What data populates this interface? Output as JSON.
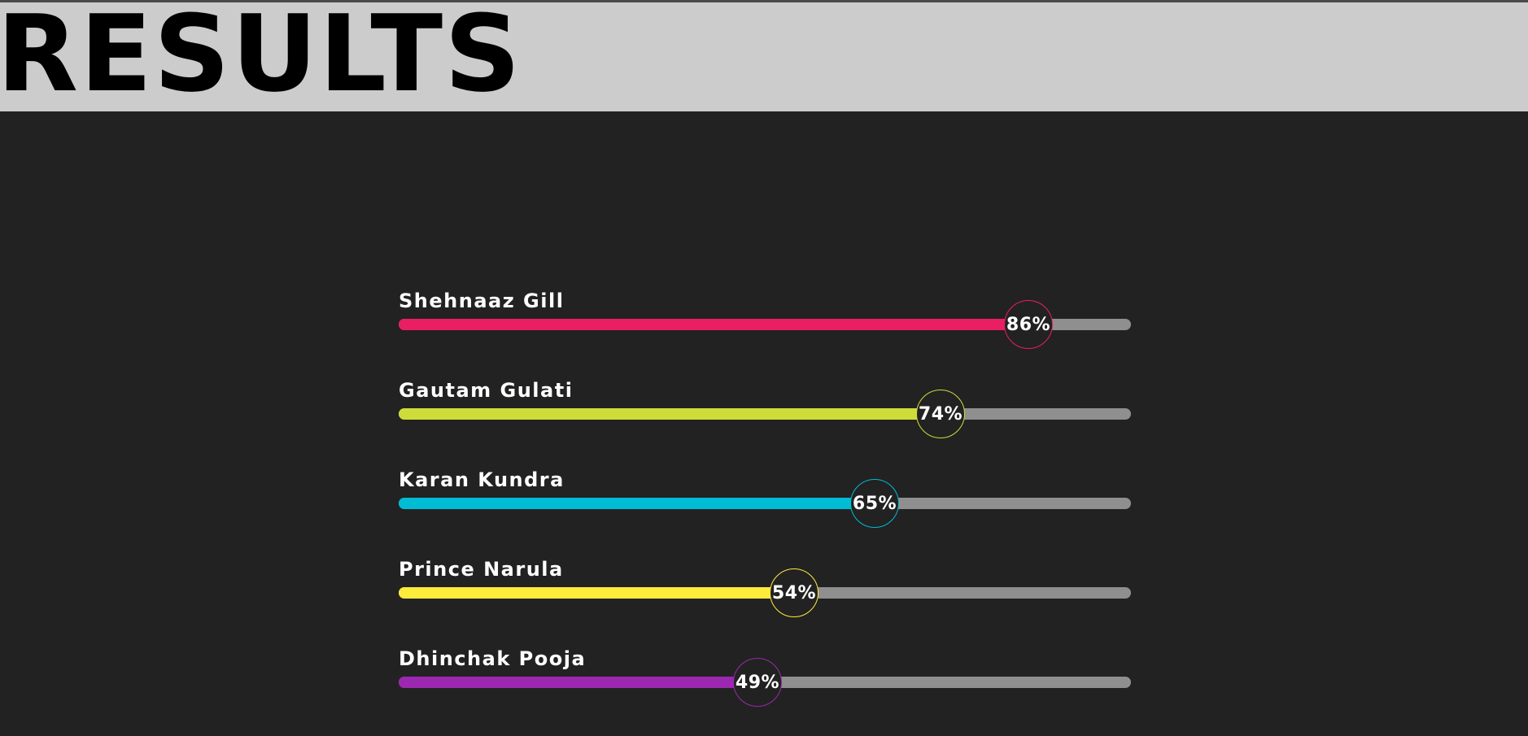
{
  "header": {
    "title": "RESULTS"
  },
  "results": [
    {
      "name": "Shehnaaz Gill",
      "percent": 86,
      "percent_label": "86%",
      "color": "#e91e63"
    },
    {
      "name": "Gautam Gulati",
      "percent": 74,
      "percent_label": "74%",
      "color": "#cddc39"
    },
    {
      "name": "Karan Kundra",
      "percent": 65,
      "percent_label": "65%",
      "color": "#00bcd4"
    },
    {
      "name": "Prince Narula",
      "percent": 54,
      "percent_label": "54%",
      "color": "#ffeb3b"
    },
    {
      "name": "Dhinchak Pooja",
      "percent": 49,
      "percent_label": "49%",
      "color": "#9c27b0"
    }
  ]
}
